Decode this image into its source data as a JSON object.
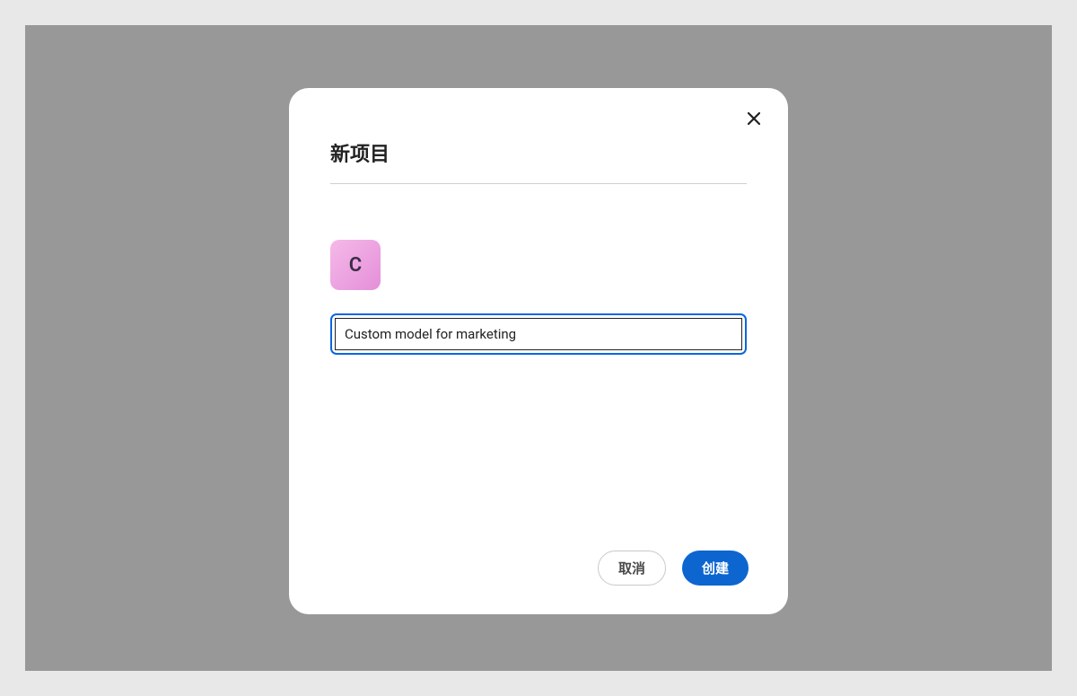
{
  "modal": {
    "title": "新项目",
    "avatar_letter": "C",
    "project_name_value": "Custom model for marketing",
    "buttons": {
      "cancel": "取消",
      "create": "创建"
    }
  }
}
